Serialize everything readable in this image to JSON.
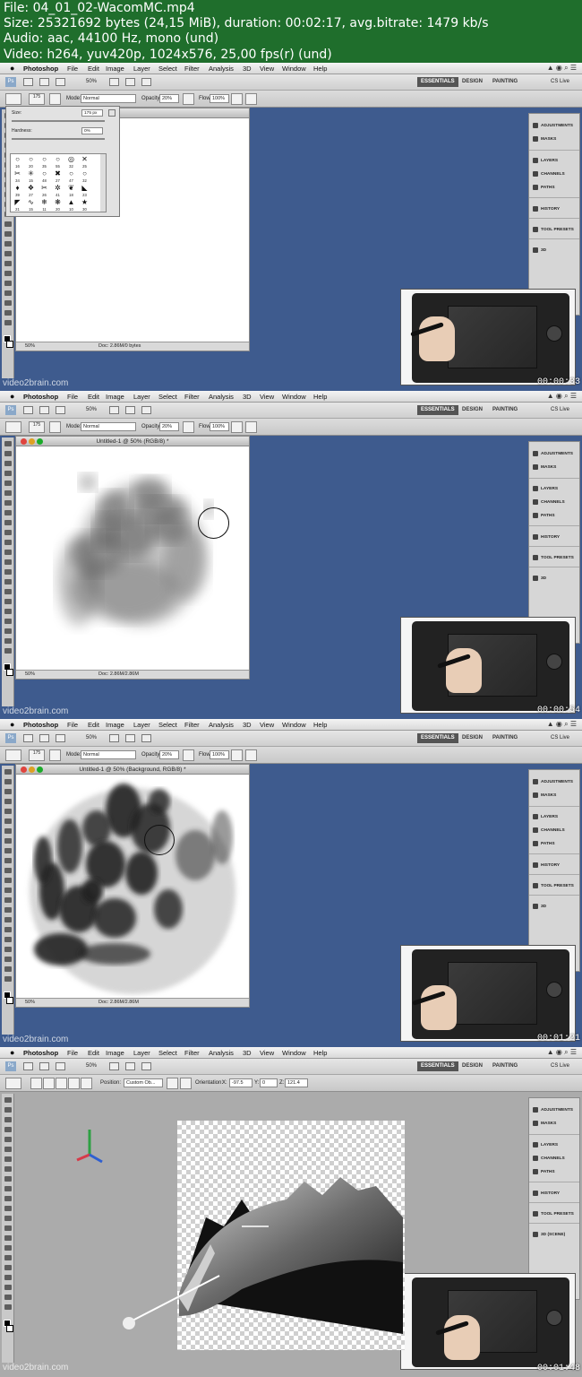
{
  "info": {
    "line1": "File: 04_01_02-WacomMC.mp4",
    "line2": "Size: 25321692 bytes (24,15 MiB), duration: 00:02:17, avg.bitrate: 1479 kb/s",
    "line3": "Audio: aac, 44100 Hz, mono (und)",
    "line4": "Video: h264, yuv420p, 1024x576, 25,00 fps(r) (und)"
  },
  "menu": [
    "Photoshop",
    "File",
    "Edit",
    "Image",
    "Layer",
    "Select",
    "Filter",
    "Analysis",
    "3D",
    "View",
    "Window",
    "Help"
  ],
  "appbar": {
    "zoom": "50%",
    "workspaces": [
      "ESSENTIALS",
      "DESIGN",
      "PAINTING"
    ],
    "cslive": "CS Live"
  },
  "options": {
    "mode_label": "Mode:",
    "mode_value": "Normal",
    "opacity_label": "Opacity:",
    "opacity_value": "20%",
    "flow_label": "Flow:",
    "flow_value": "100%",
    "brush_size_small": "175"
  },
  "options3d": {
    "position_label": "Position:",
    "position_value": "Custom Ob...",
    "orientation_label": "Orientation:",
    "x_label": "X:",
    "x_value": "-97.5",
    "y_label": "Y:",
    "y_value": "0",
    "z_label": "Z:",
    "z_value": "121.4"
  },
  "brush_popup": {
    "size_label": "Size:",
    "size_value": "175 px",
    "hardness_label": "Hardness:",
    "hardness_value": "0%",
    "presets": [
      "16",
      "20",
      "35",
      "55",
      "32",
      "25",
      "34",
      "15",
      "48",
      "27",
      "47",
      "32",
      "39",
      "27",
      "26",
      "41",
      "18",
      "23",
      "21",
      "15",
      "11",
      "20",
      "10",
      "30"
    ]
  },
  "panels": {
    "items": [
      {
        "label": "ADJUSTMENTS",
        "icon": "adjustments-icon"
      },
      {
        "label": "MASKS",
        "icon": "masks-icon"
      },
      {
        "label": "LAYERS",
        "icon": "layers-icon"
      },
      {
        "label": "CHANNELS",
        "icon": "channels-icon"
      },
      {
        "label": "PATHS",
        "icon": "paths-icon"
      },
      {
        "label": "HISTORY",
        "icon": "history-icon"
      },
      {
        "label": "TOOL PRESETS",
        "icon": "tool-presets-icon"
      },
      {
        "label": "3D",
        "icon": "3d-icon"
      }
    ],
    "last_label_3d_frame": "3D (SCENE)"
  },
  "frames": [
    {
      "doc_title": "",
      "status_zoom": "50%",
      "status_doc": "Doc: 2.86M/0 bytes",
      "timecode": "00:00:33"
    },
    {
      "doc_title": "Untitled-1 @ 50% (RGB/8) *",
      "status_zoom": "50%",
      "status_doc": "Doc: 2.86M/2.86M",
      "timecode": "00:00:54"
    },
    {
      "doc_title": "Untitled-1 @ 50% (Background, RGB/8) *",
      "status_zoom": "50%",
      "status_doc": "Doc: 2.86M/2.86M",
      "timecode": "00:01:21"
    },
    {
      "doc_title": "",
      "status_zoom": "",
      "status_doc": "",
      "timecode": "00:01:48"
    }
  ],
  "watermark": "video2brain.com",
  "colors": {
    "header_bg": "#1f6e2c",
    "workspace_blue": "#3e5b8e",
    "workspace_gray": "#ababab"
  }
}
